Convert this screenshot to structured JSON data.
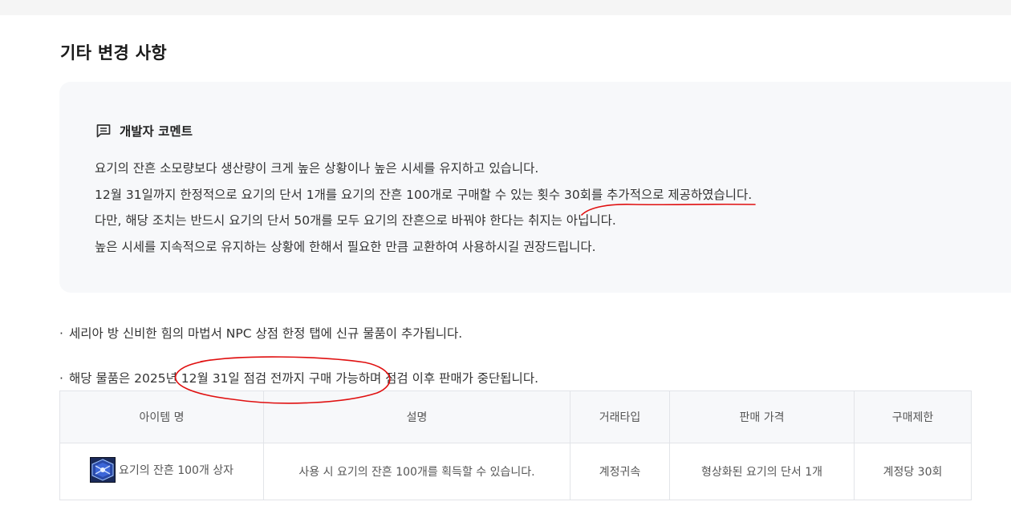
{
  "section": {
    "title": "기타 변경 사항"
  },
  "comment": {
    "icon": "comment-icon",
    "title": "개발자 코멘트",
    "lines": [
      "요기의 잔흔 소모량보다 생산량이 크게 높은 상황이나 높은 시세를 유지하고 있습니다.",
      "12월 31일까지 한정적으로 요기의 단서 1개를 요기의 잔흔 100개로 구매할 수 있는 횟수 30회를 추가적으로 제공하였습니다.",
      "다만, 해당 조치는 반드시 요기의 단서 50개를 모두 요기의 잔흔으로 바꿔야 한다는 취지는 아닙니다.",
      "높은 시세를 지속적으로 유지하는 상황에 한해서 필요한 만큼 교환하여 사용하시길 권장드립니다."
    ]
  },
  "bullets": [
    "세리아 방 신비한 힘의 마법서 NPC 상점 한정 탭에 신규 물품이 추가됩니다.",
    "해당 물품은 2025년 12월 31일 점검 전까지 구매 가능하며 점검 이후 판매가 중단됩니다."
  ],
  "bullet_marker": "·",
  "table": {
    "headers": [
      "아이템 명",
      "설명",
      "거래타입",
      "판매 가격",
      "구매제한"
    ],
    "rows": [
      {
        "icon": "item-box-icon",
        "name": "요기의 잔흔 100개 상자",
        "description": "사용 시 요기의 잔흔 100개를 획득할 수 있습니다.",
        "trade_type": "계정귀속",
        "price": "형상화된 요기의 단서 1개",
        "limit": "계정당 30회"
      }
    ]
  },
  "colors": {
    "annotation": "#e01010",
    "panel_bg": "#f7f8fa",
    "border": "#e2e4e8"
  }
}
